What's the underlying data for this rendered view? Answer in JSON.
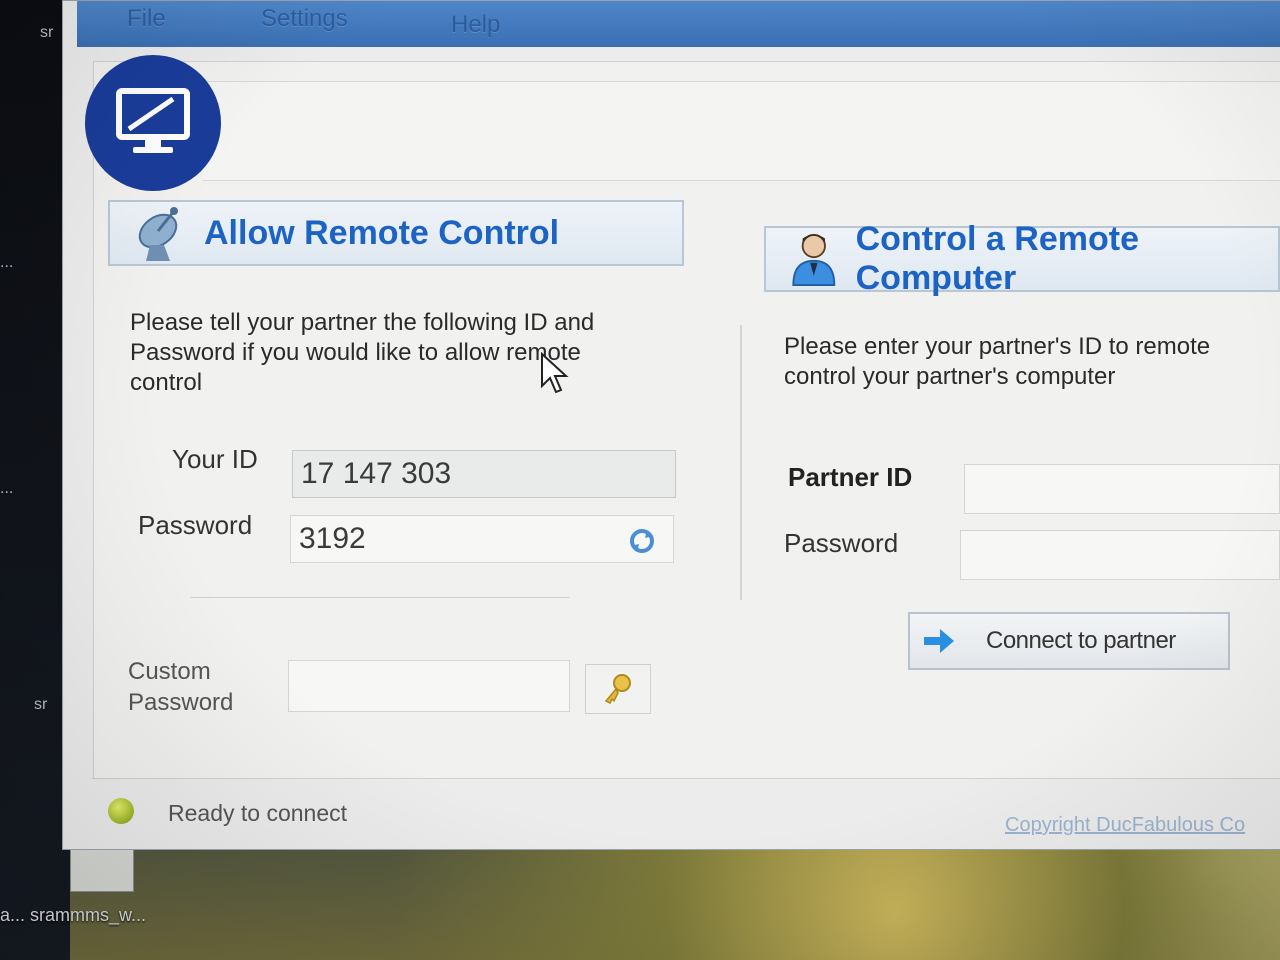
{
  "desktop": {
    "labels": [
      "sr",
      "...",
      "...",
      "sr"
    ],
    "shortcut_label": "a... srammms_w..."
  },
  "menu": {
    "file": "File",
    "settings": "Settings",
    "help": "Help"
  },
  "allow": {
    "title": "Allow Remote Control",
    "instructions": "Please tell your partner the following ID and Password if you would like to allow remote control",
    "your_id_label": "Your ID",
    "your_id_value": "17 147 303",
    "password_label": "Password",
    "password_value": "3192",
    "custom_password_label_line1": "Custom",
    "custom_password_label_line2": "Password",
    "custom_password_value": ""
  },
  "control": {
    "title": "Control a Remote Computer",
    "instructions": "Please enter your partner's ID to remote control your partner's computer",
    "partner_id_label": "Partner ID",
    "partner_id_value": "",
    "password_label": "Password",
    "password_value": "",
    "connect_label": "Connect to partner"
  },
  "status": {
    "text": "Ready to connect",
    "color": "#b5c83a"
  },
  "footer": {
    "copyright": "Copyright DucFabulous Co"
  },
  "colors": {
    "accent": "#1d63c4",
    "logo_bg": "#1a3c9a",
    "menubar": "#3a6fb3"
  },
  "icons": {
    "logo": "monitor-icon",
    "allow": "satellite-dish-icon",
    "control": "user-icon",
    "refresh": "refresh-icon",
    "key": "key-icon",
    "connect": "arrow-right-icon"
  }
}
